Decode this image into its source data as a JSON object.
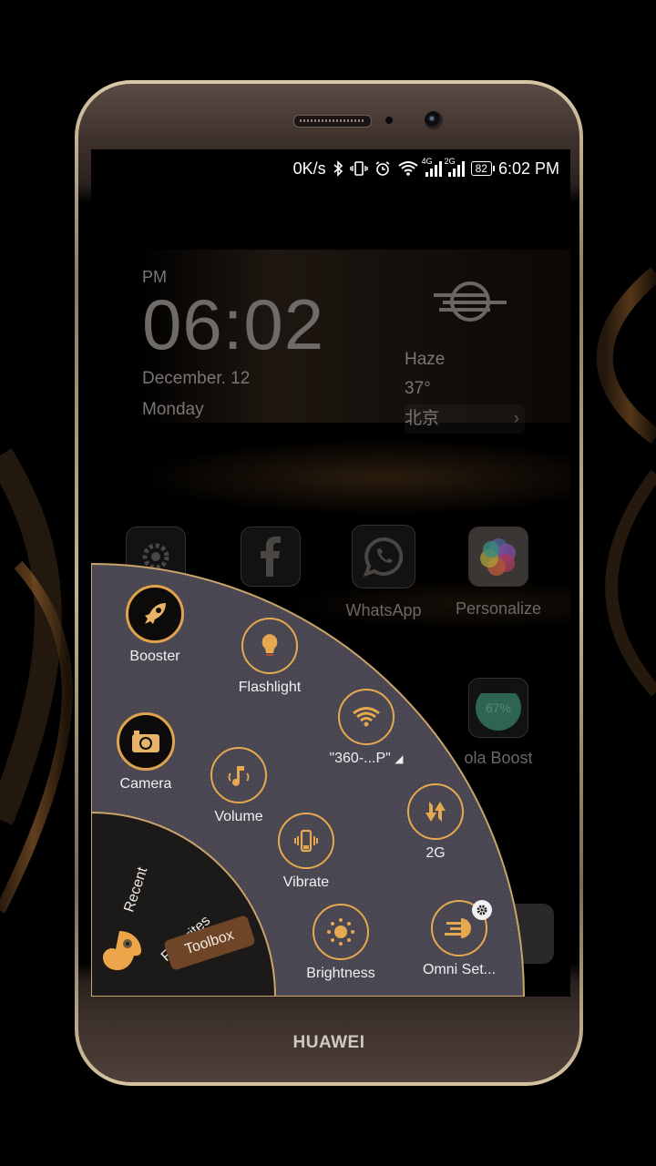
{
  "device": {
    "brand": "HUAWEI"
  },
  "status_bar": {
    "net_speed": "0K/s",
    "icons": [
      "bluetooth-icon",
      "vibrate-icon",
      "alarm-icon",
      "wifi-icon",
      "signal-4g-icon",
      "signal-2g-icon"
    ],
    "sim1_type": "4G",
    "sim2_type": "2G",
    "battery": "82",
    "time": "6:02 PM"
  },
  "clock_widget": {
    "ampm": "PM",
    "time": "06:02",
    "date": "December. 12",
    "day": "Monday"
  },
  "weather_widget": {
    "icon": "haze-icon",
    "condition": "Haze",
    "temperature": "37°",
    "city": "北京",
    "chevron": "›"
  },
  "apps": [
    {
      "label": "",
      "icon": "settings-gear-icon"
    },
    {
      "label": "",
      "icon": "facebook-icon"
    },
    {
      "label": "WhatsApp",
      "icon": "whatsapp-icon"
    },
    {
      "label": "Personalize",
      "icon": "pinwheel-icon"
    },
    {
      "label": "",
      "icon": "app-icon"
    },
    {
      "label": "ola Boost",
      "icon": "boost-icon",
      "value": "67%"
    },
    {
      "label": "",
      "icon": "app-icon"
    }
  ],
  "omni_panel": {
    "tabs": [
      {
        "label": "Recent",
        "active": false
      },
      {
        "label": "Favorites",
        "active": false
      },
      {
        "label": "Toolbox",
        "active": true
      }
    ],
    "toggles": [
      {
        "id": "booster",
        "label": "Booster",
        "icon": "rocket-icon"
      },
      {
        "id": "flashlight",
        "label": "Flashlight",
        "icon": "bulb-icon"
      },
      {
        "id": "wifi",
        "label": "\"360-...P\"",
        "icon": "wifi-icon"
      },
      {
        "id": "camera",
        "label": "Camera",
        "icon": "camera-icon"
      },
      {
        "id": "volume",
        "label": "Volume",
        "icon": "music-note-icon"
      },
      {
        "id": "mobile-data",
        "label": "2G",
        "icon": "data-sync-icon"
      },
      {
        "id": "vibrate",
        "label": "Vibrate",
        "icon": "vibrate-icon"
      },
      {
        "id": "brightness",
        "label": "Brightness",
        "icon": "sun-icon"
      },
      {
        "id": "omni-settings",
        "label": "Omni Set...",
        "icon": "omni-icon"
      }
    ],
    "accent_color": "#e6a94f",
    "panel_color": "#4a4752"
  }
}
